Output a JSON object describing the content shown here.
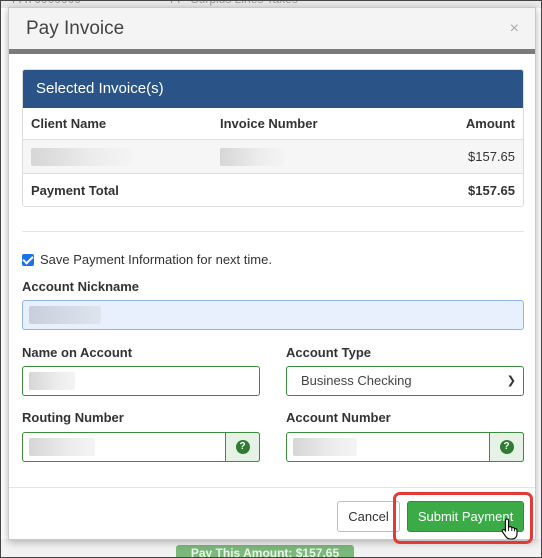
{
  "modal": {
    "title": "Pay Invoice",
    "close_symbol": "×"
  },
  "invoices_panel": {
    "heading": "Selected Invoice(s)",
    "columns": [
      "Client Name",
      "Invoice Number",
      "Amount"
    ],
    "rows": [
      {
        "client_name": "",
        "invoice_number": "",
        "amount": "$157.65"
      }
    ],
    "total_label": "Payment Total",
    "total_value": "$157.65"
  },
  "form": {
    "save_info_label": "Save Payment Information for next time.",
    "save_info_checked": true,
    "account_nickname_label": "Account Nickname",
    "name_on_account_label": "Name on Account",
    "account_type_label": "Account Type",
    "account_type_value": "Business Checking",
    "routing_number_label": "Routing Number",
    "account_number_label": "Account Number",
    "help_icon_glyph": "?"
  },
  "footer": {
    "cancel_label": "Cancel",
    "submit_label": "Submit Payment"
  },
  "colors": {
    "panel_header": "#2a5387",
    "submit_green": "#3aab47",
    "highlight_red": "#e53935"
  },
  "icons": [
    "close-icon",
    "checkbox-checked-icon",
    "chevron-down-icon",
    "help-icon",
    "hand-pointer-icon"
  ]
}
